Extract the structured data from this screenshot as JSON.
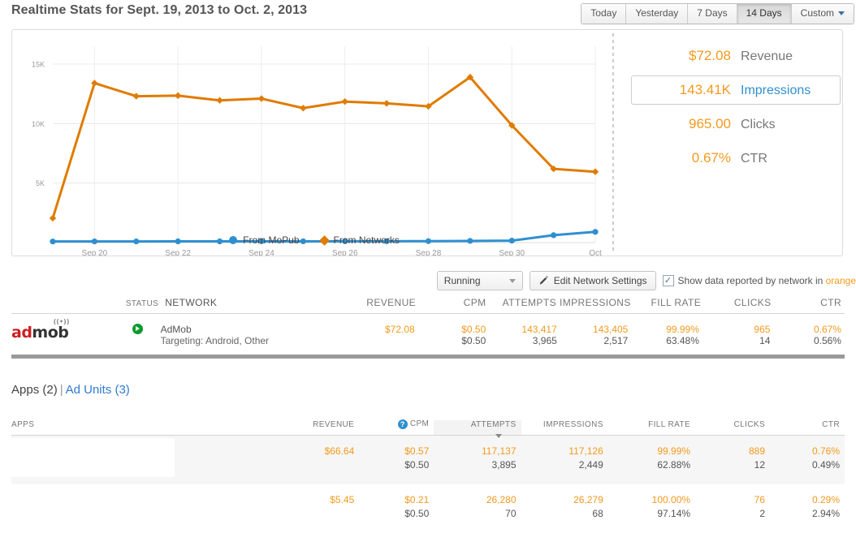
{
  "header": {
    "title": "Realtime Stats for Sept. 19, 2013 to Oct. 2, 2013",
    "ranges": [
      {
        "label": "Today",
        "active": false
      },
      {
        "label": "Yesterday",
        "active": false
      },
      {
        "label": "7 Days",
        "active": false
      },
      {
        "label": "14 Days",
        "active": true
      },
      {
        "label": "Custom",
        "active": false,
        "caret": true
      }
    ]
  },
  "chart_data": {
    "type": "line",
    "title": "",
    "xlabel": "",
    "ylabel": "",
    "ylim": [
      0,
      16500
    ],
    "yticks": [
      5000,
      10000,
      15000
    ],
    "ytick_labels": [
      "5K",
      "10K",
      "15K"
    ],
    "grid": true,
    "legend_position": "bottom",
    "x": [
      "Sep 19",
      "Sep 20",
      "Sep 21",
      "Sep 22",
      "Sep 23",
      "Sep 24",
      "Sep 25",
      "Sep 26",
      "Sep 27",
      "Sep 28",
      "Sep 29",
      "Sep 30",
      "Oct 1",
      "Oct 2"
    ],
    "xtick_labels": [
      "Sep 20",
      "Sep 22",
      "Sep 24",
      "Sep 26",
      "Sep 28",
      "Sep 30",
      "Oct"
    ],
    "xtick_indices": [
      1,
      3,
      5,
      7,
      9,
      11,
      13
    ],
    "series": [
      {
        "name": "From MoPub",
        "color": "#2f8fd0",
        "marker": "circle",
        "values": [
          90,
          95,
          95,
          100,
          100,
          105,
          105,
          110,
          110,
          120,
          140,
          160,
          620,
          900
        ]
      },
      {
        "name": "From Networks",
        "color": "#e07b00",
        "marker": "diamond",
        "values": [
          2050,
          13400,
          12300,
          12350,
          11950,
          12100,
          11300,
          11850,
          11700,
          11450,
          13900,
          9850,
          6200,
          5950
        ]
      }
    ],
    "annotations": [
      {
        "type": "vertical-dashed-line",
        "at": "Oct 2"
      }
    ]
  },
  "stats": [
    {
      "value": "$72.08",
      "label": "Revenue",
      "selected": false
    },
    {
      "value": "143.41K",
      "label": "Impressions",
      "selected": true
    },
    {
      "value": "965.00",
      "label": "Clicks",
      "selected": false
    },
    {
      "value": "0.67%",
      "label": "CTR",
      "selected": false
    }
  ],
  "toolbar": {
    "status_filter": "Running",
    "edit_button": "Edit Network Settings",
    "checkbox_checked": true,
    "checkbox_mark": "✓",
    "checkbox_label_before": "Show data reported by network in ",
    "checkbox_label_highlight": "orange"
  },
  "network_table": {
    "columns": [
      "",
      "STATUS",
      "NETWORK",
      "REVENUE",
      "CPM",
      "ATTEMPTS",
      "IMPRESSIONS",
      "FILL RATE",
      "CLICKS",
      "CTR"
    ],
    "row": {
      "logo_red": "ad",
      "logo_dark": "mob",
      "logo_wave": "((•))",
      "status": "active",
      "name": "AdMob",
      "targeting": "Targeting: Android, Other",
      "revenue": "$72.08",
      "cpm_1": "$0.50",
      "cpm_2": "$0.50",
      "attempts_1": "143,417",
      "attempts_2": "3,965",
      "impressions_1": "143,405",
      "impressions_2": "2,517",
      "fill_rate_1": "99.99%",
      "fill_rate_2": "63.48%",
      "clicks_1": "965",
      "clicks_2": "14",
      "ctr_1": "0.67%",
      "ctr_2": "0.56%"
    }
  },
  "apps_section": {
    "apps_tab": "Apps (2)",
    "separator": "|",
    "ad_units_tab": "Ad Units (3)",
    "columns": {
      "apps": "APPS",
      "revenue": "REVENUE",
      "cpm": "CPM",
      "attempts": "ATTEMPTS",
      "impressions": "IMPRESSIONS",
      "fill_rate": "FILL RATE",
      "clicks": "CLICKS",
      "ctr": "CTR"
    },
    "sorted_column": "ATTEMPTS",
    "help_icon_glyph": "?",
    "rows": [
      {
        "name": "",
        "revenue": "$66.64",
        "cpm_1": "$0.57",
        "cpm_2": "$0.50",
        "attempts_1": "117,137",
        "attempts_2": "3,895",
        "impressions_1": "117,126",
        "impressions_2": "2,449",
        "fill_rate_1": "99.99%",
        "fill_rate_2": "62.88%",
        "clicks_1": "889",
        "clicks_2": "12",
        "ctr_1": "0.76%",
        "ctr_2": "0.49%"
      },
      {
        "name": "",
        "revenue": "$5.45",
        "cpm_1": "$0.21",
        "cpm_2": "$0.50",
        "attempts_1": "26,280",
        "attempts_2": "70",
        "impressions_1": "26,279",
        "impressions_2": "68",
        "fill_rate_1": "100.00%",
        "fill_rate_2": "97.14%",
        "clicks_1": "76",
        "clicks_2": "2",
        "ctr_1": "0.29%",
        "ctr_2": "2.94%"
      }
    ]
  },
  "colors": {
    "accent_orange": "#f39a1e",
    "line_orange": "#e07b00",
    "line_blue": "#2f8fd0",
    "link_blue": "#2f7bd0",
    "status_green": "#0a9b2e"
  }
}
